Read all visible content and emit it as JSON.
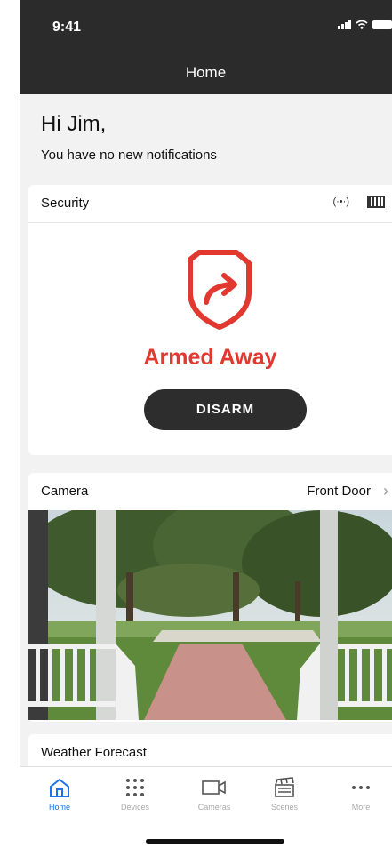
{
  "status_bar": {
    "time": "9:41"
  },
  "header": {
    "title": "Home"
  },
  "greeting": {
    "title": "Hi Jim,",
    "subtitle": "You have no new notifications"
  },
  "security": {
    "title": "Security",
    "status": "Armed Away",
    "action_label": "DISARM",
    "status_color": "#e1382f",
    "icons": [
      "radio-signal-icon",
      "keypad-icon"
    ]
  },
  "camera": {
    "title": "Camera",
    "location": "Front Door"
  },
  "weather": {
    "title": "Weather Forecast"
  },
  "tabbar": {
    "active_color": "#1a73e8",
    "items": [
      {
        "label": "Home",
        "icon": "home-icon",
        "active": true
      },
      {
        "label": "Devices",
        "icon": "grid-icon",
        "active": false
      },
      {
        "label": "Cameras",
        "icon": "camera-icon",
        "active": false
      },
      {
        "label": "Scenes",
        "icon": "clapper-icon",
        "active": false
      },
      {
        "label": "More",
        "icon": "more-icon",
        "active": false
      }
    ]
  }
}
